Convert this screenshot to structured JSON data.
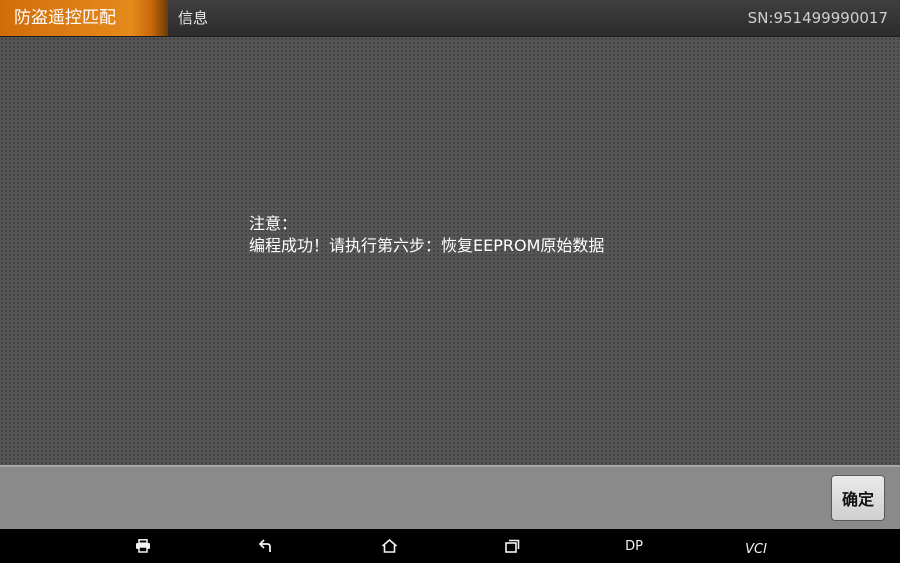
{
  "header": {
    "title": "防盗遥控匹配",
    "section": "信息",
    "serial": "SN:951499990017"
  },
  "dialog": {
    "line1": "注意：",
    "line2": "编程成功！请执行第六步：恢复EEPROM原始数据"
  },
  "footer": {
    "confirm_label": "确定"
  },
  "navbar": {
    "dp_label": "DP",
    "vci_label": "VCI"
  },
  "colors": {
    "accent": "#e58a1c",
    "header_bg": "#333333",
    "main_bg": "#565656",
    "footer_bg": "#8a8a8a"
  }
}
